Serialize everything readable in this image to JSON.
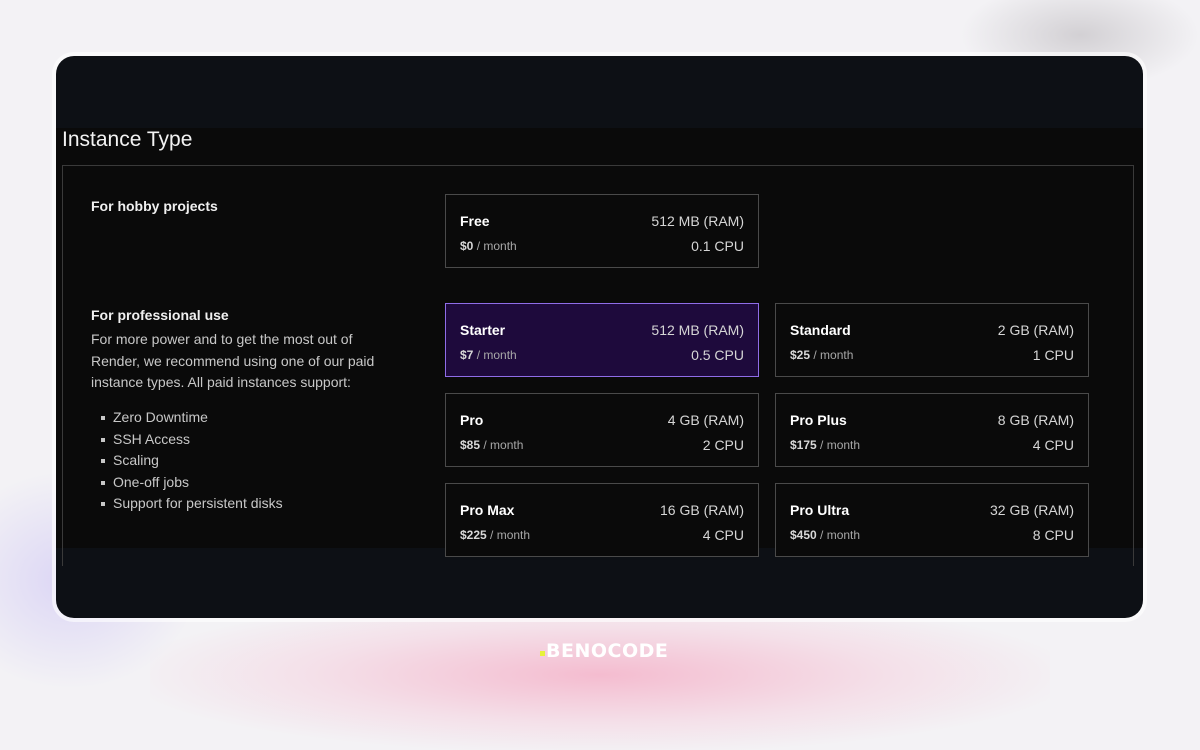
{
  "section": {
    "title": "Instance Type"
  },
  "hobby": {
    "title": "For hobby projects"
  },
  "professional": {
    "title": "For professional use",
    "description": "For more power and to get the most out of Render, we recommend using one of our paid instance types. All paid instances support:",
    "features": [
      "Zero Downtime",
      "SSH Access",
      "Scaling",
      "One-off jobs",
      "Support for persistent disks"
    ]
  },
  "per_month": "/ month",
  "plans": [
    {
      "name": "Free",
      "price": "$0",
      "ram": "512 MB (RAM)",
      "cpu": "0.1 CPU",
      "selected": false
    },
    {
      "name": "Starter",
      "price": "$7",
      "ram": "512 MB (RAM)",
      "cpu": "0.5 CPU",
      "selected": true
    },
    {
      "name": "Standard",
      "price": "$25",
      "ram": "2 GB (RAM)",
      "cpu": "1 CPU",
      "selected": false
    },
    {
      "name": "Pro",
      "price": "$85",
      "ram": "4 GB (RAM)",
      "cpu": "2 CPU",
      "selected": false
    },
    {
      "name": "Pro Plus",
      "price": "$175",
      "ram": "8 GB (RAM)",
      "cpu": "4 CPU",
      "selected": false
    },
    {
      "name": "Pro Max",
      "price": "$225",
      "ram": "16 GB (RAM)",
      "cpu": "4 CPU",
      "selected": false
    },
    {
      "name": "Pro Ultra",
      "price": "$450",
      "ram": "32 GB (RAM)",
      "cpu": "8 CPU",
      "selected": false
    }
  ],
  "branding": {
    "logo_text": "BENOCODE",
    "accent_color": "#8f6de8",
    "selected_bg": "#1e0a3c"
  }
}
